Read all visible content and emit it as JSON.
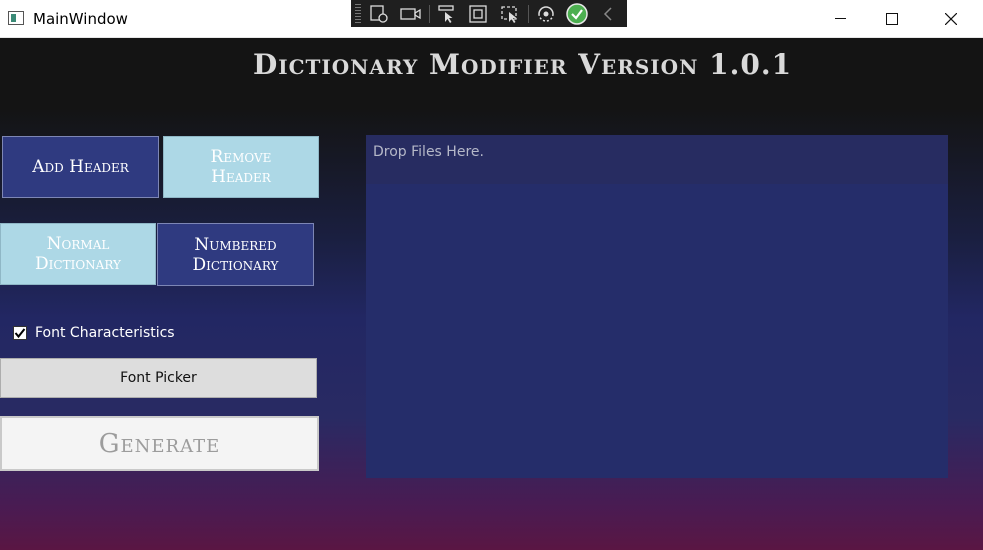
{
  "window": {
    "title": "MainWindow",
    "controls": [
      "minimize",
      "maximize",
      "close"
    ]
  },
  "devtools": {
    "tools": [
      "select-element-icon",
      "video-camera-icon",
      "pointer-select-icon",
      "frame-icon",
      "track-focus-icon",
      "hot-reload-icon",
      "check-circle-icon",
      "collapse-chevron-icon"
    ]
  },
  "app": {
    "title": "Dictionary Modifier Version 1.0.1",
    "buttons": {
      "add_header": "Add Header",
      "remove_header": "Remove Header",
      "normal_dictionary": "Normal Dictionary",
      "numbered_dictionary": "Numbered Dictionary",
      "font_picker": "Font Picker",
      "generate": "Generate"
    },
    "font_characteristics": {
      "label": "Font Characteristics",
      "checked": true
    },
    "drop_zone": {
      "placeholder": "Drop Files Here."
    }
  },
  "colors": {
    "dark_button": "#2f3a80",
    "light_button": "#add8e6",
    "drop_zone": "#252d6a"
  }
}
